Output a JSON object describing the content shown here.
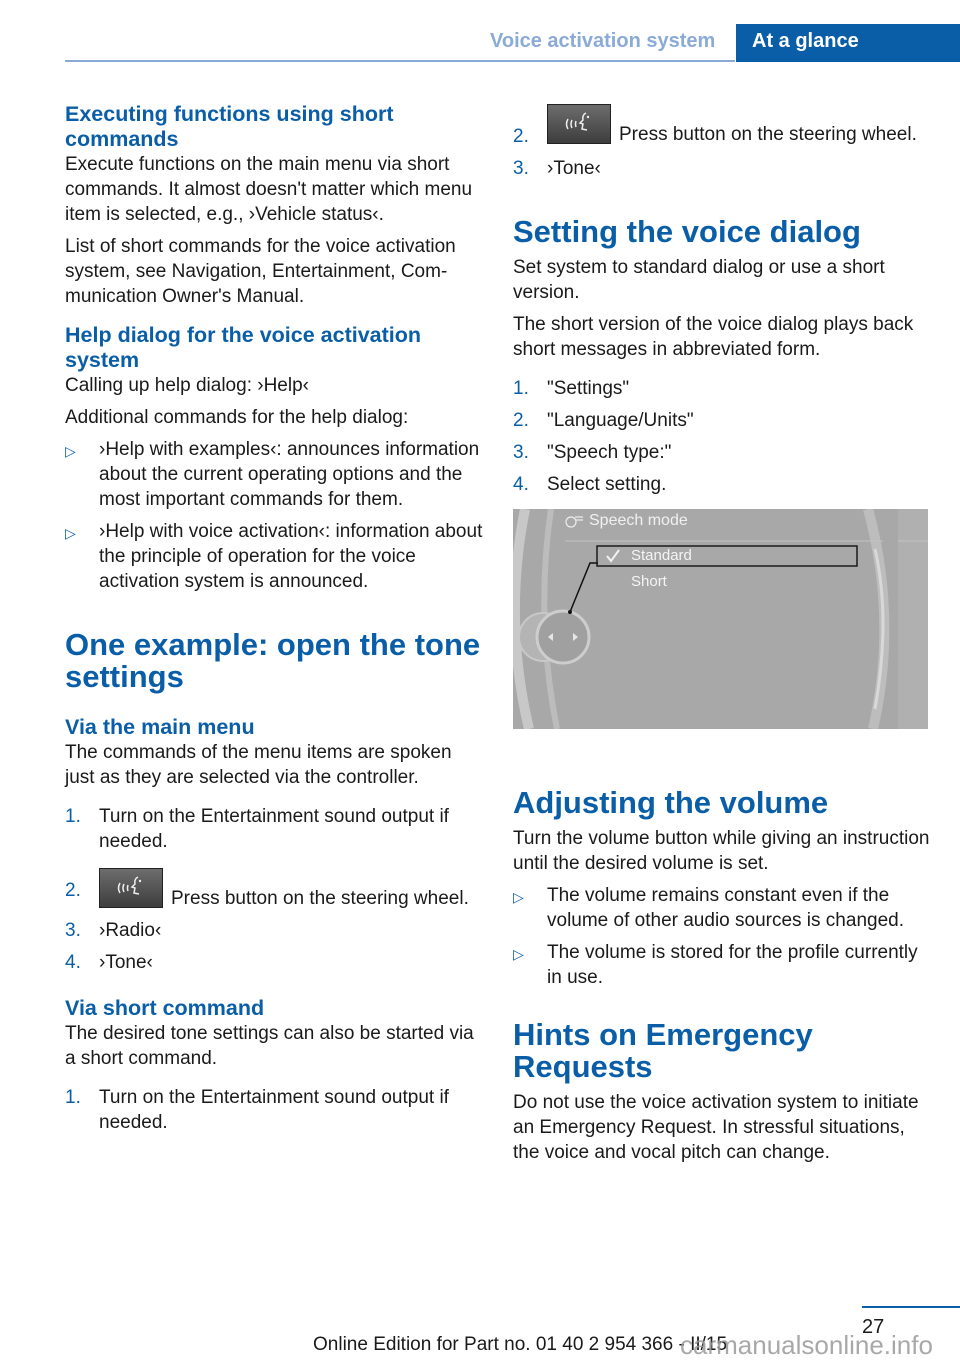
{
  "header": {
    "section": "Voice activation system",
    "tab": "At a glance"
  },
  "left": {
    "s1_title": "Executing functions using short commands",
    "s1_p1": "Execute functions on the main menu via short commands. It almost doesn't matter which menu item is selected, e.g., ›Vehicle status‹.",
    "s1_p2": "List of short commands for the voice activation system, see Navigation, Entertainment, Com­munication Owner's Manual.",
    "s2_title": "Help dialog for the voice activation system",
    "s2_p1": "Calling up help dialog: ›Help‹",
    "s2_p2": "Additional commands for the help dialog:",
    "s2_bullets": [
      "›Help with examples‹: announces informa­tion about the current operating options and the most important commands for them.",
      "›Help with voice activation‹: information about the principle of operation for the voice activation system is announced."
    ],
    "s3_title": "One example: open the tone settings",
    "s3a_title": "Via the main menu",
    "s3a_p": "The commands of the menu items are spoken just as they are selected via the controller.",
    "s3a_steps": [
      {
        "num": "1.",
        "text": "Turn on the Entertainment sound output if needed."
      },
      {
        "num": "2.",
        "text": "Press button on the steering wheel."
      },
      {
        "num": "3.",
        "text": "›Radio‹"
      },
      {
        "num": "4.",
        "text": "›Tone‹"
      }
    ],
    "s3b_title": "Via short command",
    "s3b_p": "The desired tone settings can also be started via a short command.",
    "s3b_steps": [
      {
        "num": "1.",
        "text": "Turn on the Entertainment sound output if needed."
      }
    ]
  },
  "right": {
    "cont_steps": [
      {
        "num": "2.",
        "text": "Press button on the steering wheel."
      },
      {
        "num": "3.",
        "text": "›Tone‹"
      }
    ],
    "s4_title": "Setting the voice dialog",
    "s4_p1": "Set system to standard dialog or use a short version.",
    "s4_p2": "The short version of the voice dialog plays back short messages in abbreviated form.",
    "s4_steps": [
      {
        "num": "1.",
        "text": "\"Settings\""
      },
      {
        "num": "2.",
        "text": "\"Language/Units\""
      },
      {
        "num": "3.",
        "text": "\"Speech type:\""
      },
      {
        "num": "4.",
        "text": "Select setting."
      }
    ],
    "screen": {
      "title": "Speech mode",
      "options": [
        {
          "label": "Standard",
          "selected": true
        },
        {
          "label": "Short",
          "selected": false
        }
      ]
    },
    "s5_title": "Adjusting the volume",
    "s5_p": "Turn the volume button while giving an in­struction until the desired volume is set.",
    "s5_bullets": [
      "The volume remains constant even if the volume of other audio sources is changed.",
      "The volume is stored for the profile cur­rently in use."
    ],
    "s6_title": "Hints on Emergency Requests",
    "s6_p": "Do not use the voice activation system to ini­tiate an Emergency Request. In stressful situa­tions, the voice and vocal pitch can change."
  },
  "footer": {
    "page": "27",
    "edition": "Online Edition for Part no. 01 40 2 954 366 - II/15",
    "watermark": "carmanualsonline.info"
  },
  "icons": {
    "bullet": "▷"
  }
}
